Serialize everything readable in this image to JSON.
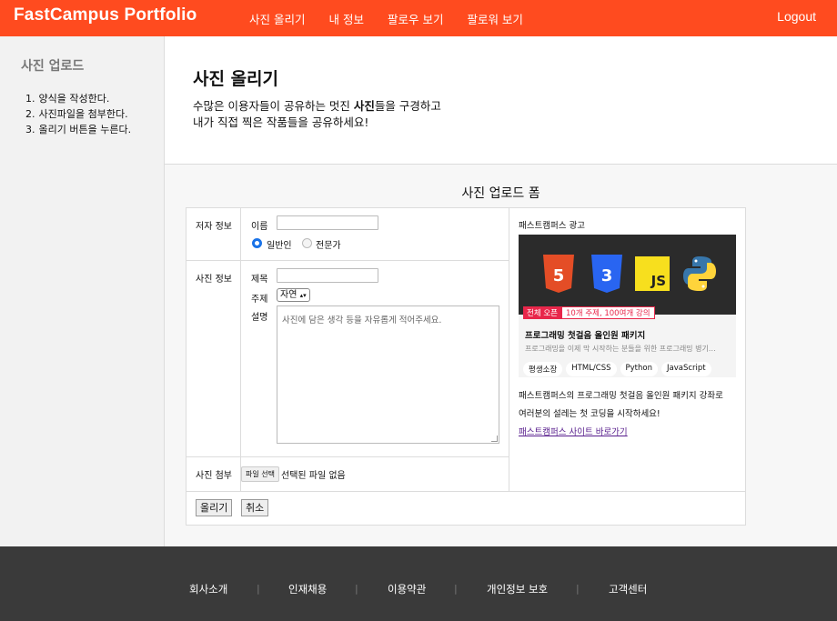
{
  "header": {
    "brand": "FastCampus Portfolio",
    "nav": [
      "사진 올리기",
      "내 정보",
      "팔로우 보기",
      "팔로워 보기"
    ],
    "logout": "Logout",
    "accent_color": "#ff4b1f"
  },
  "sidebar": {
    "title": "사진 업로드",
    "steps": [
      {
        "n": "1.",
        "text": "양식을 작성한다."
      },
      {
        "n": "2.",
        "text": "사진파일을 첨부한다."
      },
      {
        "n": "3.",
        "text": "올리기 버튼을 누른다."
      }
    ]
  },
  "intro": {
    "title": "사진 올리기",
    "line1_pre": "수많은 이용자들이 공유하는 멋진 ",
    "line1_bold": "사진",
    "line1_post": "들을 구경하고",
    "line2": "내가 직접 찍은 작품들을 공유하세요!"
  },
  "form": {
    "title": "사진 업로드 폼",
    "author": {
      "label": "저자 정보",
      "name_label": "이름",
      "name_value": "",
      "type_options": [
        "일반인",
        "전문가"
      ],
      "type_selected": "일반인"
    },
    "photo": {
      "label": "사진 정보",
      "title_label": "제목",
      "title_value": "",
      "topic_label": "주제",
      "topic_value": "자연",
      "desc_label": "설명",
      "desc_placeholder": "사진에 담은 생각 등을 자유롭게 적어주세요."
    },
    "attach": {
      "label": "사진 첨부",
      "button": "파일 선택",
      "status": "선택된 파일 없음"
    },
    "submit": "올리기",
    "cancel": "취소"
  },
  "ad": {
    "title": "패스트캠퍼스 광고",
    "logos": [
      "html5-icon",
      "css3-icon",
      "js-icon",
      "python-icon"
    ],
    "logo_text": {
      "html5": "5",
      "css3": "3",
      "js": "JS"
    },
    "badge1": "전체 오픈",
    "badge2": "10개 주제, 100여개 강의",
    "headline": "프로그래밍 첫걸음 올인원 패키지",
    "sub": "프로그래밍을 이제 막 시작하는 분들을 위한 프로그래밍 병기…",
    "tags": [
      "평생소장",
      "HTML/CSS",
      "Python",
      "JavaScript"
    ],
    "desc1": "패스트캠퍼스의 프로그래밍 첫걸음 올인원 패키지 강좌로",
    "desc2": "여러분의 설레는 첫 코딩을 시작하세요!",
    "link": "패스트캠퍼스 사이트 바로가기"
  },
  "footer": {
    "links": [
      "회사소개",
      "인재채용",
      "이용약관",
      "개인정보 보호",
      "고객센터"
    ],
    "separator": "|"
  }
}
